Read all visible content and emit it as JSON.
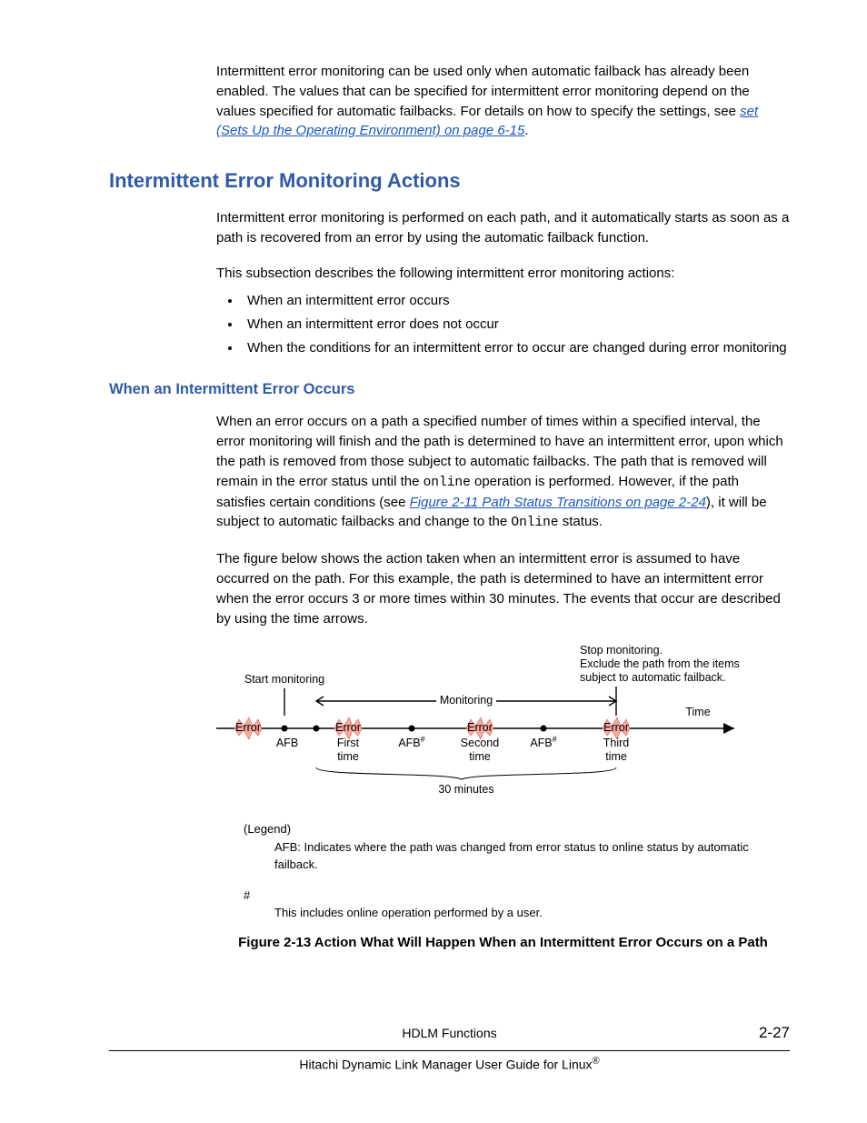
{
  "para1_a": "Intermittent error monitoring can be used only when automatic failback has already been enabled. The values that can be specified for intermittent error monitoring depend on the values specified for automatic failbacks. For details on how to specify the settings, see ",
  "para1_link": "set (Sets Up the Operating Environment) on page 6-15",
  "para1_b": ".",
  "heading_main": "Intermittent Error Monitoring Actions",
  "para2": "Intermittent error monitoring is performed on each path, and it automatically starts as soon as a path is recovered from an error by using the automatic failback function.",
  "para3": "This subsection describes the following intermittent error monitoring actions:",
  "bullets": [
    "When an intermittent error occurs",
    "When an intermittent error does not occur",
    "When the conditions for an intermittent error to occur are changed during error monitoring"
  ],
  "heading_sub": "When an Intermittent Error Occurs",
  "para4_a": "When an error occurs on a path a specified number of times within a specified interval, the error monitoring will finish and the path is determined to have an intermittent error, upon which the path is removed from those subject to automatic failbacks. The path that is removed will remain in the error status until the ",
  "para4_mono1": "online",
  "para4_b": " operation is performed. However, if the path satisfies certain conditions (see ",
  "para4_link": "Figure 2-11 Path Status Transitions on page 2-24",
  "para4_c": "), it will be subject to automatic failbacks and change to the ",
  "para4_mono2": "Online",
  "para4_d": " status.",
  "para5": "The figure below shows the action taken when an intermittent error is assumed to have occurred on the path. For this example, the path is determined to have an intermittent error when the error occurs 3 or more times within 30 minutes. The events that occur are described by using the time arrows.",
  "fig": {
    "start_monitoring": "Start monitoring",
    "stop_note_1": "Stop monitoring.",
    "stop_note_2": "Exclude the path from the  items",
    "stop_note_3": "subject to automatic failback.",
    "monitoring": "Monitoring",
    "time": "Time",
    "error": "Error",
    "afb": "AFB",
    "afb_hash": "AFB",
    "first": "First",
    "second": "Second",
    "third": "Third",
    "time_lc": "time",
    "thirty": "30 minutes",
    "legend_title": "(Legend)",
    "legend_afb": "AFB: Indicates where the path was changed from error status to online status by automatic failback.",
    "hash": "#",
    "hash_note": "This includes online operation performed by a user."
  },
  "figure_caption": "Figure 2-13 Action What Will Happen When an Intermittent Error Occurs on a Path",
  "footer_chapter": "HDLM Functions",
  "footer_pageno": "2-27",
  "footer_book_a": "Hitachi Dynamic Link Manager User Guide for Linux",
  "footer_book_reg": "®"
}
